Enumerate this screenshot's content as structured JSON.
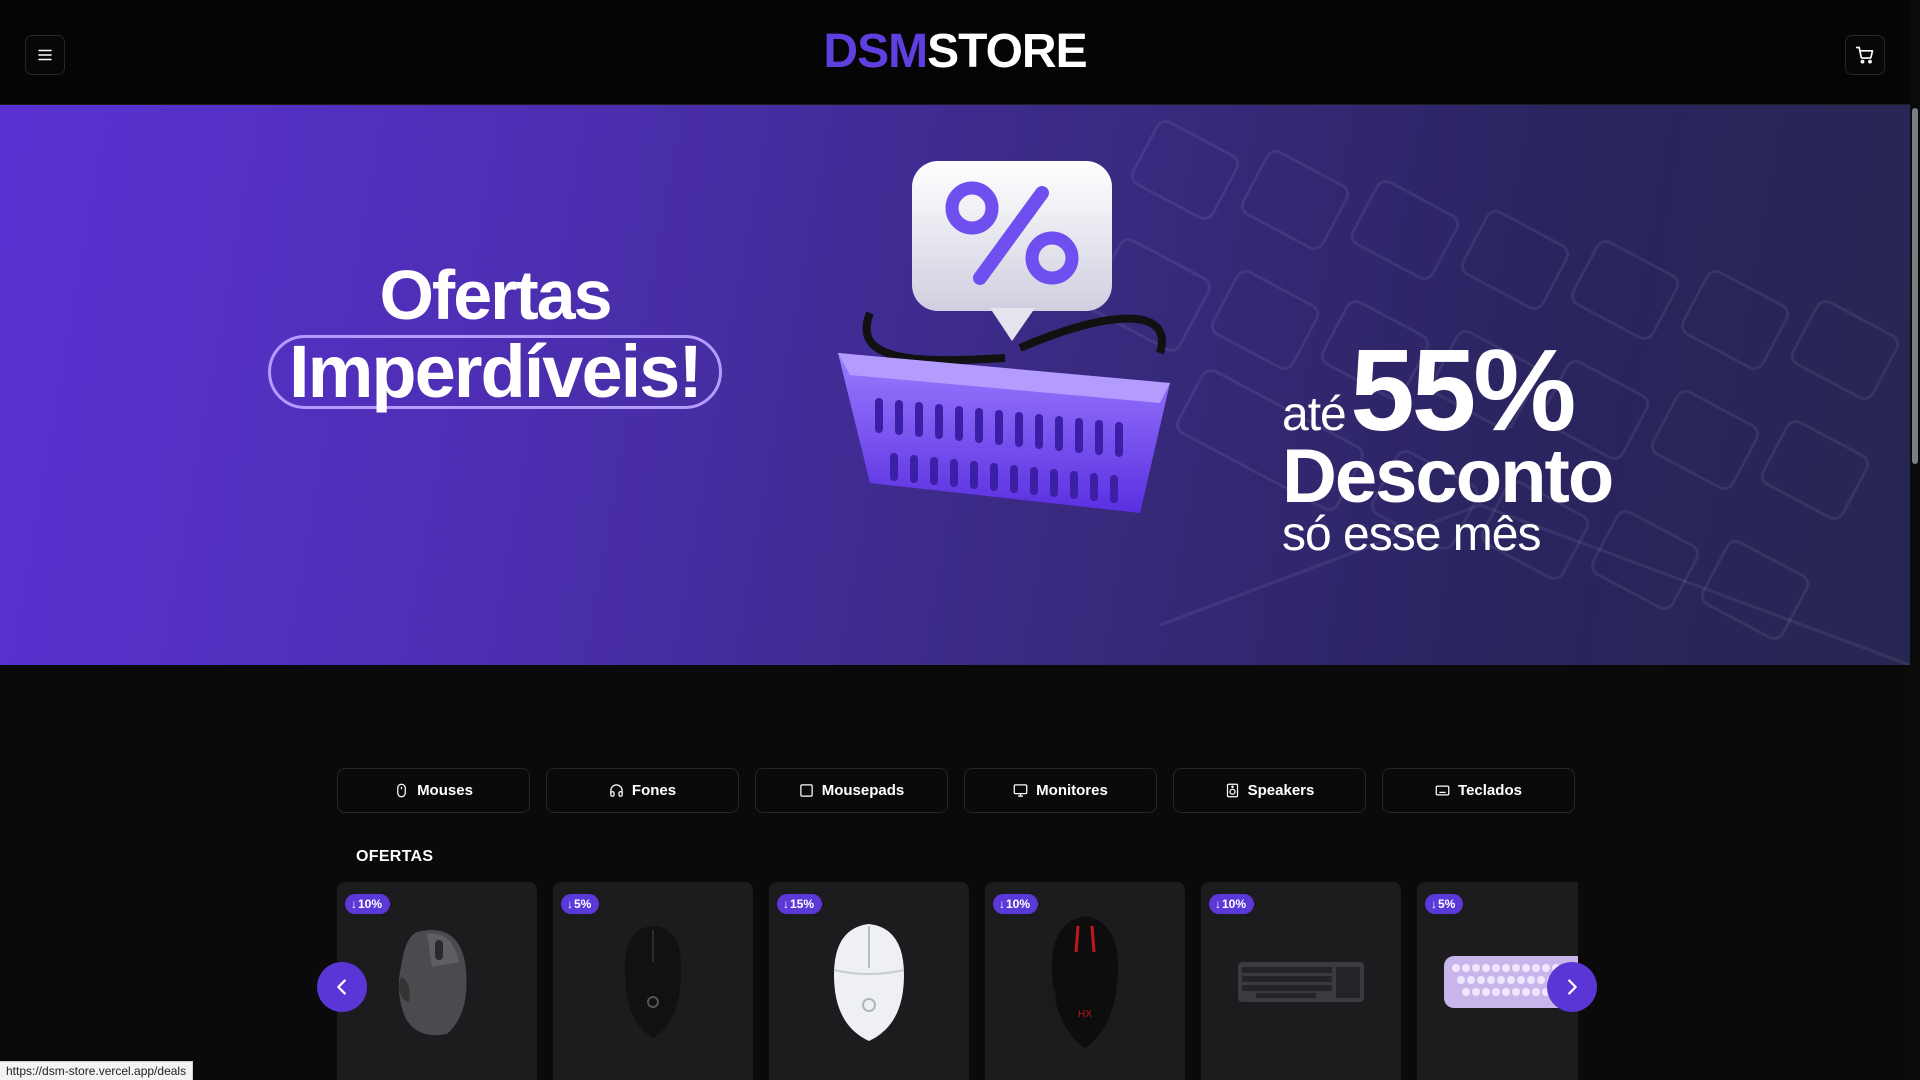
{
  "header": {
    "logo_accent": "DSM",
    "logo_main": "STORE",
    "menu_icon": "menu-icon",
    "cart_icon": "cart-icon"
  },
  "banner": {
    "headline_line1": "Ofertas",
    "headline_line2": "Imperdíveis!",
    "discount_prefix": "até",
    "discount_value": "55%",
    "discount_word": "Desconto",
    "discount_suffix": "só esse mês"
  },
  "categories": [
    {
      "label": "Mouses",
      "icon": "mouse-icon"
    },
    {
      "label": "Fones",
      "icon": "headphones-icon"
    },
    {
      "label": "Mousepads",
      "icon": "square-icon"
    },
    {
      "label": "Monitores",
      "icon": "monitor-icon"
    },
    {
      "label": "Speakers",
      "icon": "speaker-icon"
    },
    {
      "label": "Teclados",
      "icon": "keyboard-icon"
    }
  ],
  "deals": {
    "title": "OFERTAS",
    "items": [
      {
        "discount": "10%",
        "image": "gray-ergonomic-mouse"
      },
      {
        "discount": "5%",
        "image": "black-gaming-mouse"
      },
      {
        "discount": "15%",
        "image": "white-gaming-mouse"
      },
      {
        "discount": "10%",
        "image": "black-red-gaming-mouse"
      },
      {
        "discount": "10%",
        "image": "dark-keyboard"
      },
      {
        "discount": "5%",
        "image": "lavender-keyboard"
      }
    ]
  },
  "status_bar": {
    "url": "https://dsm-store.vercel.app/deals"
  },
  "colors": {
    "accent": "#5b38d8",
    "background": "#0a0a0a",
    "card": "#1c1c1f"
  }
}
